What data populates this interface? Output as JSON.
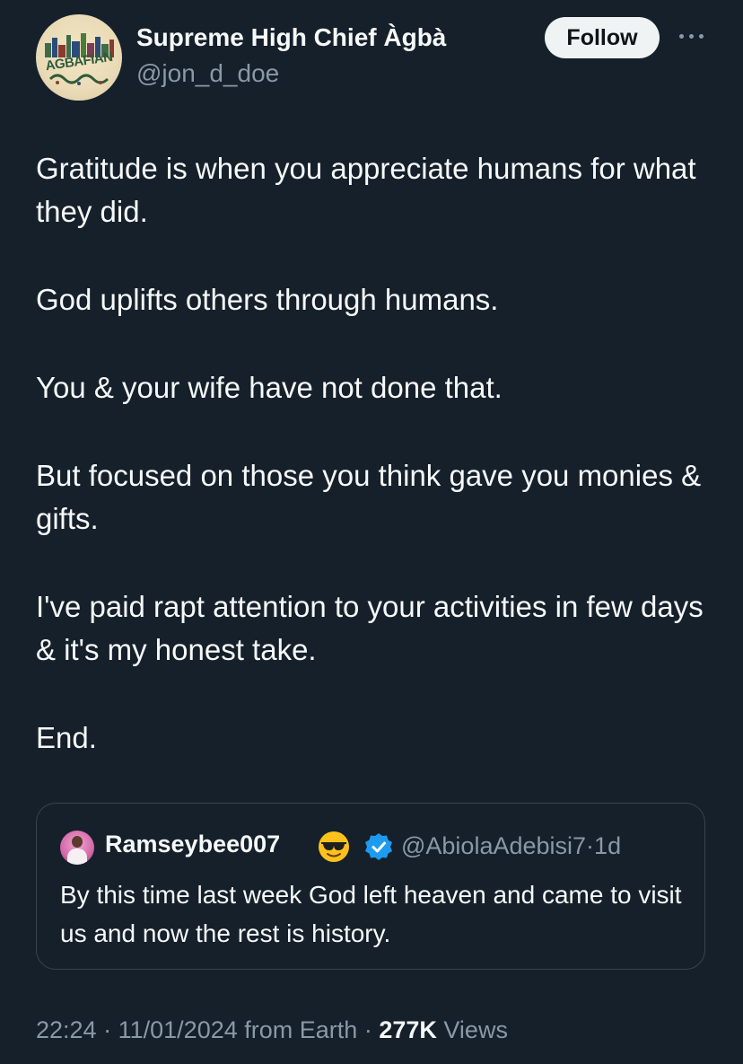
{
  "author": {
    "name": "Supreme High Chief Àgbà",
    "handle": "@jon_d_doe",
    "avatar_text": "AGBAFIAN"
  },
  "actions": {
    "follow_label": "Follow"
  },
  "tweet": {
    "paragraphs": [
      "Gratitude is when you appreciate humans for what they did.",
      "God uplifts others through humans.",
      "You & your wife have not done that.",
      "But focused on those you think gave you monies & gifts.",
      "I've paid rapt attention to your activities in few days & it's my honest take.",
      "End."
    ]
  },
  "quoted": {
    "name": "Ramseybee007",
    "emoji": "smiling-face-with-sunglasses",
    "verified": true,
    "handle": "@AbiolaAdebisi7",
    "separator": "·",
    "time": "1d",
    "text": "By this time last week God left heaven and came to visit us and now the rest is history."
  },
  "footer": {
    "time": "22:24",
    "separator": "·",
    "date": "11/01/2024",
    "source": "from Earth",
    "views_count": "277K",
    "views_label": "Views"
  },
  "colors": {
    "background": "#15202b",
    "text": "#f7f9f9",
    "secondary": "#8b98a5",
    "border": "#38444d",
    "verified": "#1d9bf0"
  }
}
